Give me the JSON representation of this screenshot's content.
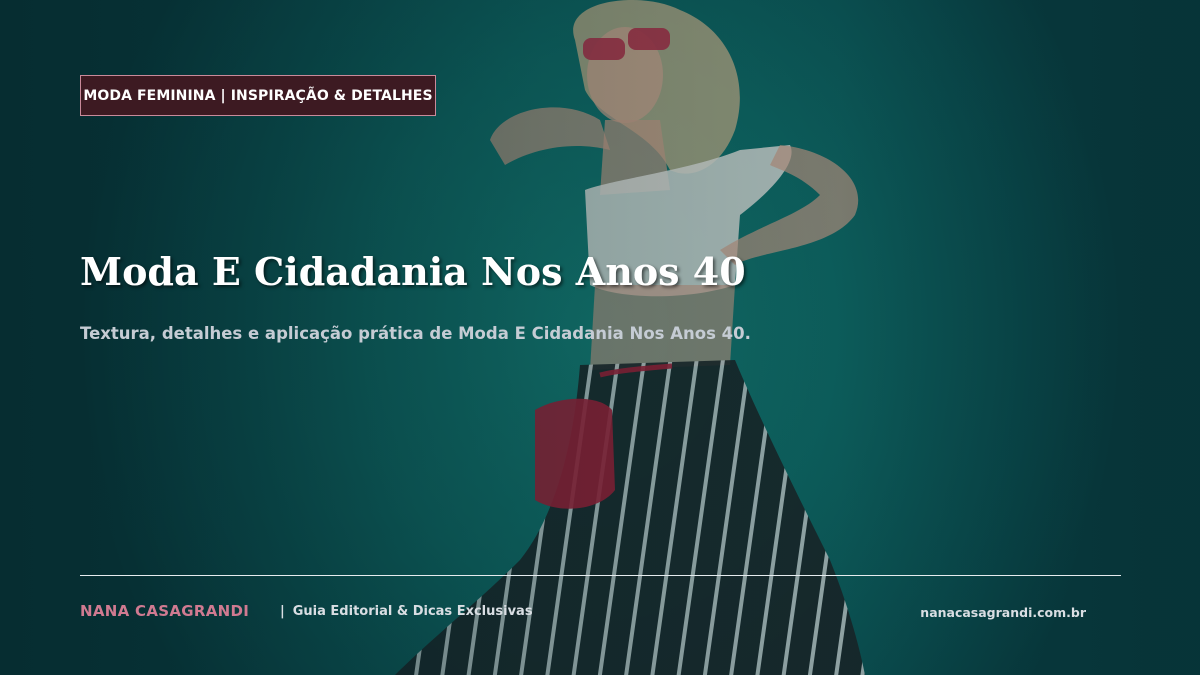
{
  "category_tag": "MODA FEMININA | INSPIRAÇÃO & DETALHES",
  "headline": "Moda E Cidadania Nos Anos 40",
  "subheadline": "Textura, detalhes e aplicação prática de Moda E Cidadania Nos Anos 40.",
  "footer": {
    "brand": "NANA CASAGRANDI",
    "separator": "|",
    "tagline": "Guia Editorial & Dicas Exclusivas",
    "website": "nanacasagrandi.com.br"
  },
  "colors": {
    "background_teal": "#0e6764",
    "tag_background": "#3d1a22",
    "tag_border": "#c98a9a",
    "brand_pink": "#d07a91",
    "subtitle_gray": "#c5ccd4"
  }
}
